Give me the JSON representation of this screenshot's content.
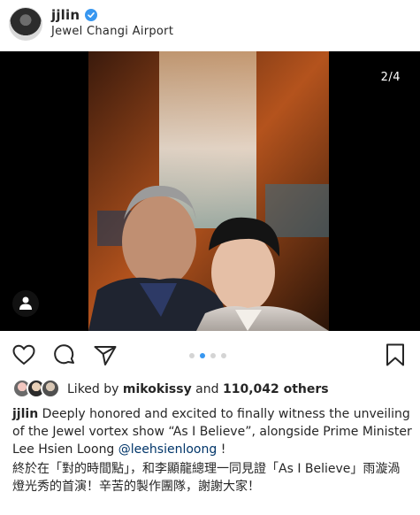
{
  "post": {
    "username": "jjlin",
    "verified": true,
    "location": "Jewel Changi Airport",
    "image_counter": "2/4",
    "carousel": {
      "total": 4,
      "active_index": 1
    }
  },
  "likes": {
    "prefix": "Liked by",
    "user": "mikokissy",
    "connector": "and",
    "count_text": "110,042 others"
  },
  "caption": {
    "username": "jjlin",
    "text": "Deeply honored and excited to finally witness the unveiling of the Jewel vortex show “As I Believe”, alongside Prime Minister Lee Hsien Loong",
    "mention": "@leehsienloong",
    "suffix": "!",
    "chinese_text": "終於在「對的時間點」，和李顯龍總理一同見證「As I Believe」雨漩渦燈光秀的首演！辛苦的製作團隊，謝謝大家！"
  },
  "icons": {
    "like": "heart-icon",
    "comment": "comment-icon",
    "share": "send-icon",
    "save": "bookmark-icon",
    "tag": "user-tag-icon",
    "verified": "verified-badge-icon"
  },
  "colors": {
    "accent": "#3897f0",
    "mention": "#003569",
    "text": "#262626",
    "dot_inactive": "#d4d4d4"
  }
}
